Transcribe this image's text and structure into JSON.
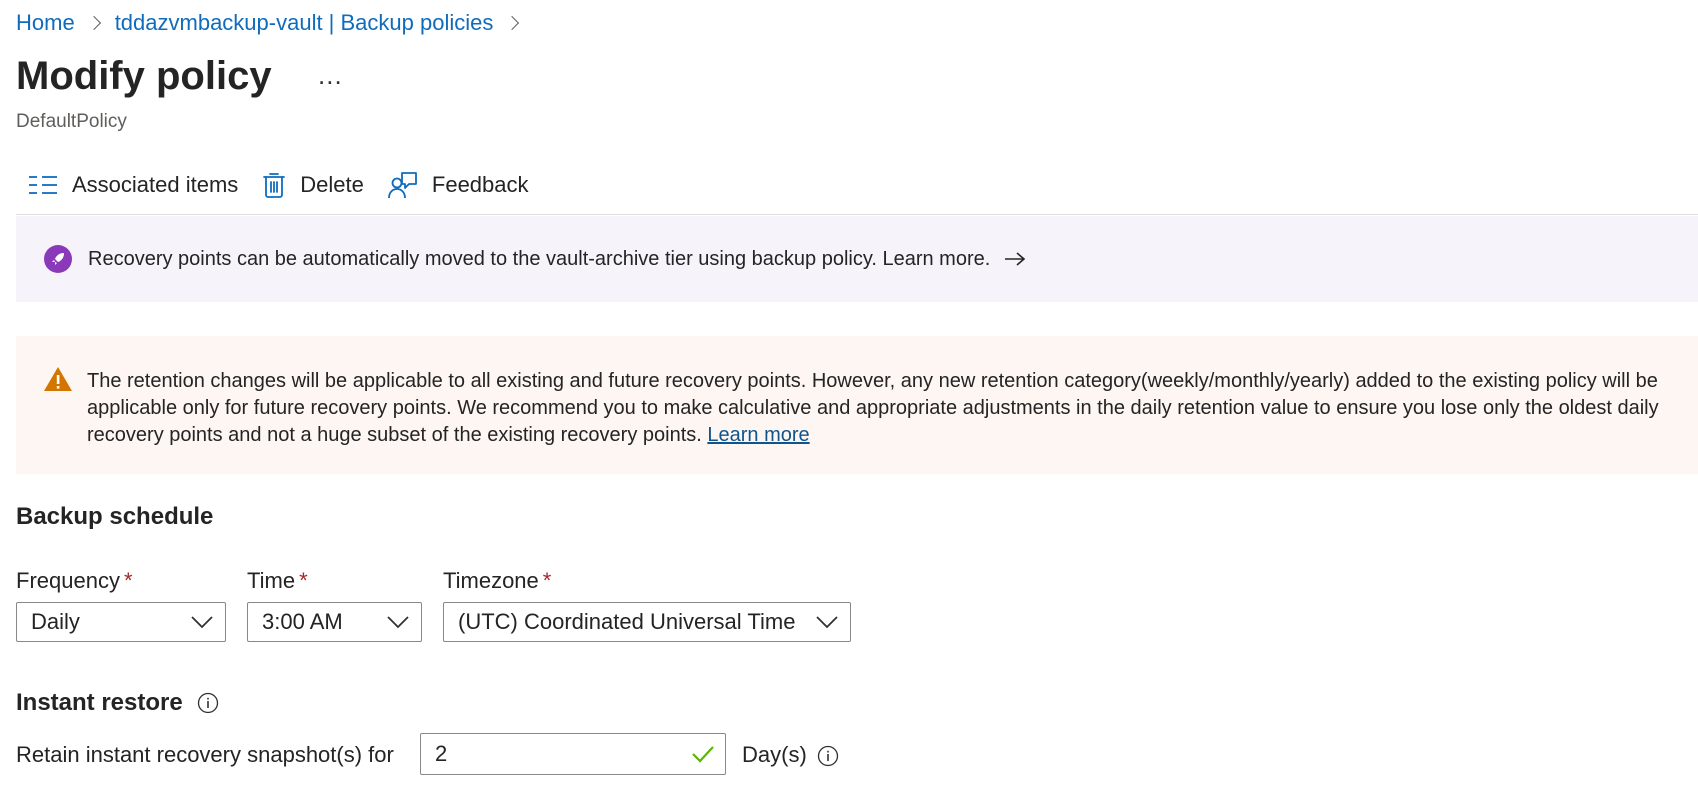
{
  "breadcrumb": {
    "items": [
      "Home",
      "tddazvmbackup-vault | Backup policies"
    ]
  },
  "header": {
    "title": "Modify policy",
    "more": "...",
    "subtitle": "DefaultPolicy"
  },
  "toolbar": {
    "associated_items": "Associated items",
    "delete": "Delete",
    "feedback": "Feedback"
  },
  "info_banner": {
    "text": "Recovery points can be automatically moved to the vault-archive tier using backup policy. Learn more."
  },
  "warning_banner": {
    "text": "The retention changes will be applicable to all existing and future recovery points. However, any new retention category(weekly/monthly/yearly) added to the existing policy will be applicable only for future recovery points. We recommend you to make calculative and appropriate adjustments in the daily retention value to ensure you lose only the oldest daily recovery points and not a huge subset of the existing recovery points.",
    "link": "Learn more"
  },
  "backup_schedule": {
    "heading": "Backup schedule",
    "frequency": {
      "label": "Frequency",
      "required": "*",
      "value": "Daily"
    },
    "time": {
      "label": "Time",
      "required": "*",
      "value": "3:00 AM"
    },
    "timezone": {
      "label": "Timezone",
      "required": "*",
      "value": "(UTC) Coordinated Universal Time"
    }
  },
  "instant_restore": {
    "heading": "Instant restore",
    "retain_label": "Retain instant recovery snapshot(s) for",
    "retain_value": "2",
    "unit": "Day(s)"
  },
  "colors": {
    "link": "#0f6cbd",
    "info_bg": "#f7f3fb",
    "info_icon": "#8a3ab9",
    "warning_bg": "#fdf6f3",
    "warning_icon": "#d47500",
    "required": "#a4262c",
    "valid_check": "#5bb600"
  }
}
